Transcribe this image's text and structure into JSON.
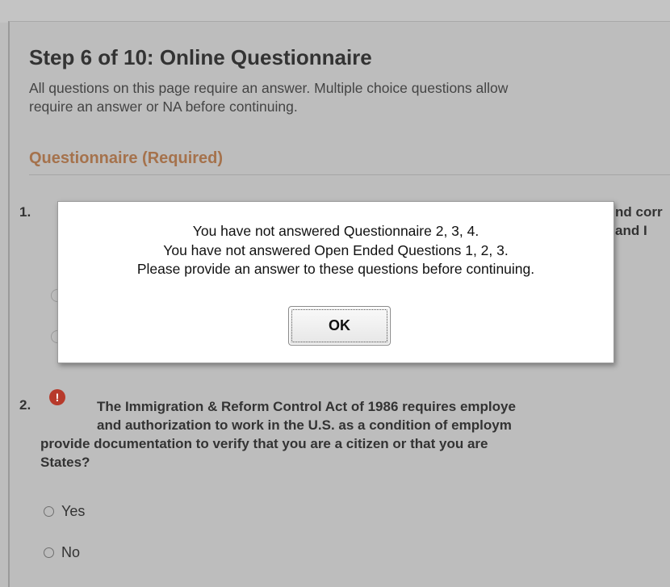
{
  "page": {
    "step_title": "Step 6 of 10: Online Questionnaire",
    "instructions_line1": "All questions on this page require an answer. Multiple choice questions allow",
    "instructions_line2": "require an answer or NA before continuing.",
    "section_title": "Questionnaire (Required)"
  },
  "question1": {
    "number": "1.",
    "visible_fragment_line1": "nd corr",
    "visible_fragment_line2": "and I"
  },
  "question2": {
    "number": "2.",
    "error_symbol": "!",
    "line1": "The Immigration & Reform Control Act of 1986 requires employe",
    "line2": "and authorization to work in the U.S. as a condition of employm",
    "line3": "provide documentation to verify that you are a citizen or that you are",
    "line4": "States?",
    "options": [
      "Yes",
      "No"
    ]
  },
  "modal": {
    "line1": "You have not answered Questionnaire 2, 3, 4.",
    "line2": "You have not answered Open Ended Questions 1, 2, 3.",
    "line3": "Please provide an answer to these questions before continuing.",
    "ok_label": "OK"
  },
  "colors": {
    "overlay_background": "#bdbdbd",
    "section_title": "#a5724c",
    "error_icon": "#b73a2b",
    "modal_background": "#ffffff"
  }
}
